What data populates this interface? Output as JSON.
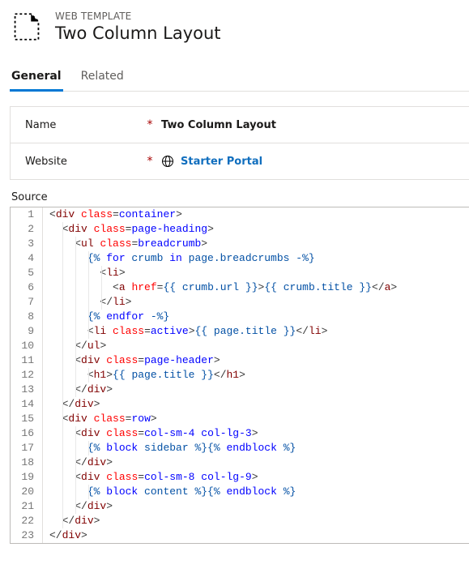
{
  "header": {
    "eyebrow": "WEB TEMPLATE",
    "title": "Two Column Layout"
  },
  "tabs": [
    {
      "id": "general",
      "label": "General",
      "active": true
    },
    {
      "id": "related",
      "label": "Related",
      "active": false
    }
  ],
  "form": {
    "name_label": "Name",
    "name_value": "Two Column Layout",
    "website_label": "Website",
    "website_value": "Starter Portal",
    "required_marker": "*"
  },
  "source": {
    "label": "Source",
    "lines": [
      {
        "n": 1,
        "indent": 0,
        "tokens": [
          {
            "t": "punc",
            "v": "<"
          },
          {
            "t": "tag",
            "v": "div"
          },
          {
            "t": "text",
            "v": " "
          },
          {
            "t": "attr",
            "v": "class"
          },
          {
            "t": "punc",
            "v": "="
          },
          {
            "t": "liq",
            "v": "container"
          },
          {
            "t": "punc",
            "v": ">"
          }
        ]
      },
      {
        "n": 2,
        "indent": 1,
        "tokens": [
          {
            "t": "punc",
            "v": "<"
          },
          {
            "t": "tag",
            "v": "div"
          },
          {
            "t": "text",
            "v": " "
          },
          {
            "t": "attr",
            "v": "class"
          },
          {
            "t": "punc",
            "v": "="
          },
          {
            "t": "liq",
            "v": "page-heading"
          },
          {
            "t": "punc",
            "v": ">"
          }
        ]
      },
      {
        "n": 3,
        "indent": 2,
        "tokens": [
          {
            "t": "punc",
            "v": "<"
          },
          {
            "t": "tag",
            "v": "ul"
          },
          {
            "t": "text",
            "v": " "
          },
          {
            "t": "attr",
            "v": "class"
          },
          {
            "t": "punc",
            "v": "="
          },
          {
            "t": "liq",
            "v": "breadcrumb"
          },
          {
            "t": "punc",
            "v": ">"
          }
        ]
      },
      {
        "n": 4,
        "indent": 3,
        "tokens": [
          {
            "t": "must",
            "v": "{% "
          },
          {
            "t": "liq",
            "v": "for"
          },
          {
            "t": "must",
            "v": " crumb "
          },
          {
            "t": "liq",
            "v": "in"
          },
          {
            "t": "must",
            "v": " page.breadcrumbs -%}"
          }
        ]
      },
      {
        "n": 5,
        "indent": 4,
        "tokens": [
          {
            "t": "punc",
            "v": "<"
          },
          {
            "t": "tag",
            "v": "li"
          },
          {
            "t": "punc",
            "v": ">"
          }
        ]
      },
      {
        "n": 6,
        "indent": 5,
        "tokens": [
          {
            "t": "punc",
            "v": "<"
          },
          {
            "t": "tag",
            "v": "a"
          },
          {
            "t": "text",
            "v": " "
          },
          {
            "t": "attr",
            "v": "href"
          },
          {
            "t": "punc",
            "v": "="
          },
          {
            "t": "must",
            "v": "{{"
          },
          {
            "t": "must",
            "v": " crumb.url "
          },
          {
            "t": "must",
            "v": "}}"
          },
          {
            "t": "punc",
            "v": ">"
          },
          {
            "t": "must",
            "v": "{{"
          },
          {
            "t": "must",
            "v": " crumb.title "
          },
          {
            "t": "must",
            "v": "}}"
          },
          {
            "t": "punc",
            "v": "</"
          },
          {
            "t": "tag",
            "v": "a"
          },
          {
            "t": "punc",
            "v": ">"
          }
        ]
      },
      {
        "n": 7,
        "indent": 4,
        "tokens": [
          {
            "t": "punc",
            "v": "</"
          },
          {
            "t": "tag",
            "v": "li"
          },
          {
            "t": "punc",
            "v": ">"
          }
        ]
      },
      {
        "n": 8,
        "indent": 3,
        "tokens": [
          {
            "t": "must",
            "v": "{% "
          },
          {
            "t": "liq",
            "v": "endfor"
          },
          {
            "t": "must",
            "v": " -%}"
          }
        ]
      },
      {
        "n": 9,
        "indent": 3,
        "tokens": [
          {
            "t": "punc",
            "v": "<"
          },
          {
            "t": "tag",
            "v": "li"
          },
          {
            "t": "text",
            "v": " "
          },
          {
            "t": "attr",
            "v": "class"
          },
          {
            "t": "punc",
            "v": "="
          },
          {
            "t": "liq",
            "v": "active"
          },
          {
            "t": "punc",
            "v": ">"
          },
          {
            "t": "must",
            "v": "{{"
          },
          {
            "t": "must",
            "v": " page.title "
          },
          {
            "t": "must",
            "v": "}}"
          },
          {
            "t": "punc",
            "v": "</"
          },
          {
            "t": "tag",
            "v": "li"
          },
          {
            "t": "punc",
            "v": ">"
          }
        ]
      },
      {
        "n": 10,
        "indent": 2,
        "tokens": [
          {
            "t": "punc",
            "v": "</"
          },
          {
            "t": "tag",
            "v": "ul"
          },
          {
            "t": "punc",
            "v": ">"
          }
        ]
      },
      {
        "n": 11,
        "indent": 2,
        "tokens": [
          {
            "t": "punc",
            "v": "<"
          },
          {
            "t": "tag",
            "v": "div"
          },
          {
            "t": "text",
            "v": " "
          },
          {
            "t": "attr",
            "v": "class"
          },
          {
            "t": "punc",
            "v": "="
          },
          {
            "t": "liq",
            "v": "page-header"
          },
          {
            "t": "punc",
            "v": ">"
          }
        ]
      },
      {
        "n": 12,
        "indent": 3,
        "tokens": [
          {
            "t": "punc",
            "v": "<"
          },
          {
            "t": "tag",
            "v": "h1"
          },
          {
            "t": "punc",
            "v": ">"
          },
          {
            "t": "must",
            "v": "{{"
          },
          {
            "t": "must",
            "v": " page.title "
          },
          {
            "t": "must",
            "v": "}}"
          },
          {
            "t": "punc",
            "v": "</"
          },
          {
            "t": "tag",
            "v": "h1"
          },
          {
            "t": "punc",
            "v": ">"
          }
        ]
      },
      {
        "n": 13,
        "indent": 2,
        "tokens": [
          {
            "t": "punc",
            "v": "</"
          },
          {
            "t": "tag",
            "v": "div"
          },
          {
            "t": "punc",
            "v": ">"
          }
        ]
      },
      {
        "n": 14,
        "indent": 1,
        "tokens": [
          {
            "t": "punc",
            "v": "</"
          },
          {
            "t": "tag",
            "v": "div"
          },
          {
            "t": "punc",
            "v": ">"
          }
        ]
      },
      {
        "n": 15,
        "indent": 1,
        "tokens": [
          {
            "t": "punc",
            "v": "<"
          },
          {
            "t": "tag",
            "v": "div"
          },
          {
            "t": "text",
            "v": " "
          },
          {
            "t": "attr",
            "v": "class"
          },
          {
            "t": "punc",
            "v": "="
          },
          {
            "t": "liq",
            "v": "row"
          },
          {
            "t": "punc",
            "v": ">"
          }
        ]
      },
      {
        "n": 16,
        "indent": 2,
        "tokens": [
          {
            "t": "punc",
            "v": "<"
          },
          {
            "t": "tag",
            "v": "div"
          },
          {
            "t": "text",
            "v": " "
          },
          {
            "t": "attr",
            "v": "class"
          },
          {
            "t": "punc",
            "v": "="
          },
          {
            "t": "liq",
            "v": "col-sm-4 col-lg-3"
          },
          {
            "t": "punc",
            "v": ">"
          }
        ]
      },
      {
        "n": 17,
        "indent": 3,
        "tokens": [
          {
            "t": "must",
            "v": "{% "
          },
          {
            "t": "liq",
            "v": "block"
          },
          {
            "t": "must",
            "v": " sidebar "
          },
          {
            "t": "must",
            "v": "%}{% "
          },
          {
            "t": "liq",
            "v": "endblock"
          },
          {
            "t": "must",
            "v": " %}"
          }
        ]
      },
      {
        "n": 18,
        "indent": 2,
        "tokens": [
          {
            "t": "punc",
            "v": "</"
          },
          {
            "t": "tag",
            "v": "div"
          },
          {
            "t": "punc",
            "v": ">"
          }
        ]
      },
      {
        "n": 19,
        "indent": 2,
        "tokens": [
          {
            "t": "punc",
            "v": "<"
          },
          {
            "t": "tag",
            "v": "div"
          },
          {
            "t": "text",
            "v": " "
          },
          {
            "t": "attr",
            "v": "class"
          },
          {
            "t": "punc",
            "v": "="
          },
          {
            "t": "liq",
            "v": "col-sm-8 col-lg-9"
          },
          {
            "t": "punc",
            "v": ">"
          }
        ]
      },
      {
        "n": 20,
        "indent": 3,
        "tokens": [
          {
            "t": "must",
            "v": "{% "
          },
          {
            "t": "liq",
            "v": "block"
          },
          {
            "t": "must",
            "v": " content "
          },
          {
            "t": "must",
            "v": "%}{% "
          },
          {
            "t": "liq",
            "v": "endblock"
          },
          {
            "t": "must",
            "v": " %}"
          }
        ]
      },
      {
        "n": 21,
        "indent": 2,
        "tokens": [
          {
            "t": "punc",
            "v": "</"
          },
          {
            "t": "tag",
            "v": "div"
          },
          {
            "t": "punc",
            "v": ">"
          }
        ]
      },
      {
        "n": 22,
        "indent": 1,
        "tokens": [
          {
            "t": "punc",
            "v": "</"
          },
          {
            "t": "tag",
            "v": "div"
          },
          {
            "t": "punc",
            "v": ">"
          }
        ]
      },
      {
        "n": 23,
        "indent": 0,
        "tokens": [
          {
            "t": "punc",
            "v": "</"
          },
          {
            "t": "tag",
            "v": "div"
          },
          {
            "t": "punc",
            "v": ">"
          }
        ]
      }
    ]
  }
}
